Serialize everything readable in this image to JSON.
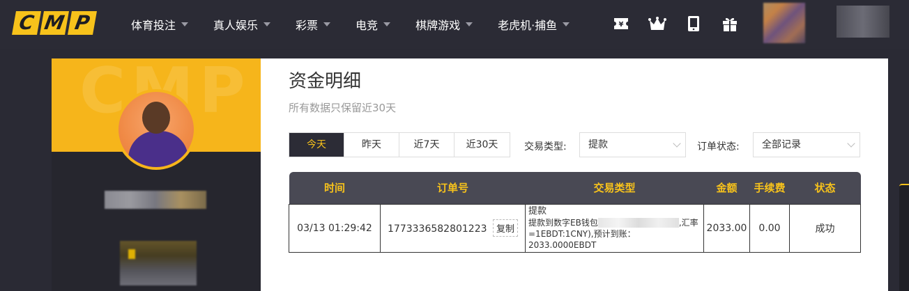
{
  "logo": {
    "letters": [
      "C",
      "M",
      "P"
    ]
  },
  "nav": {
    "items": [
      {
        "label": "体育投注"
      },
      {
        "label": "真人娱乐"
      },
      {
        "label": "彩票"
      },
      {
        "label": "电竞"
      },
      {
        "label": "棋牌游戏"
      },
      {
        "label": "老虎机·捕鱼"
      }
    ],
    "tools": [
      "ticket-icon",
      "crown-icon",
      "mobile-icon",
      "gift-icon"
    ]
  },
  "page": {
    "title": "资金明细",
    "subtitle": "所有数据只保留近30天"
  },
  "filters": {
    "day_tabs": [
      {
        "label": "今天",
        "active": true
      },
      {
        "label": "昨天",
        "active": false
      },
      {
        "label": "近7天",
        "active": false
      },
      {
        "label": "近30天",
        "active": false
      }
    ],
    "type_label": "交易类型:",
    "type_value": "提款",
    "status_label": "订单状态:",
    "status_value": "全部记录"
  },
  "table": {
    "headers": [
      "时间",
      "订单号",
      "交易类型",
      "金额",
      "手续费",
      "状态"
    ],
    "rows": [
      {
        "time": "03/13 01:29:42",
        "order_no": "1773336582801223",
        "copy_label": "复制",
        "type_title": "提款",
        "type_detail_prefix": "提款到数字EB钱包",
        "type_detail_suffix": ",汇率=1EBDT:1CNY),预计到账：2033.0000EBDT",
        "amount": "2033.00",
        "fee": "0.00",
        "status": "成功"
      }
    ]
  },
  "colors": {
    "accent": "#f7c21b",
    "nav_bg": "#2b2b35",
    "header_bg": "#494954",
    "success": "#2e8b3d"
  }
}
